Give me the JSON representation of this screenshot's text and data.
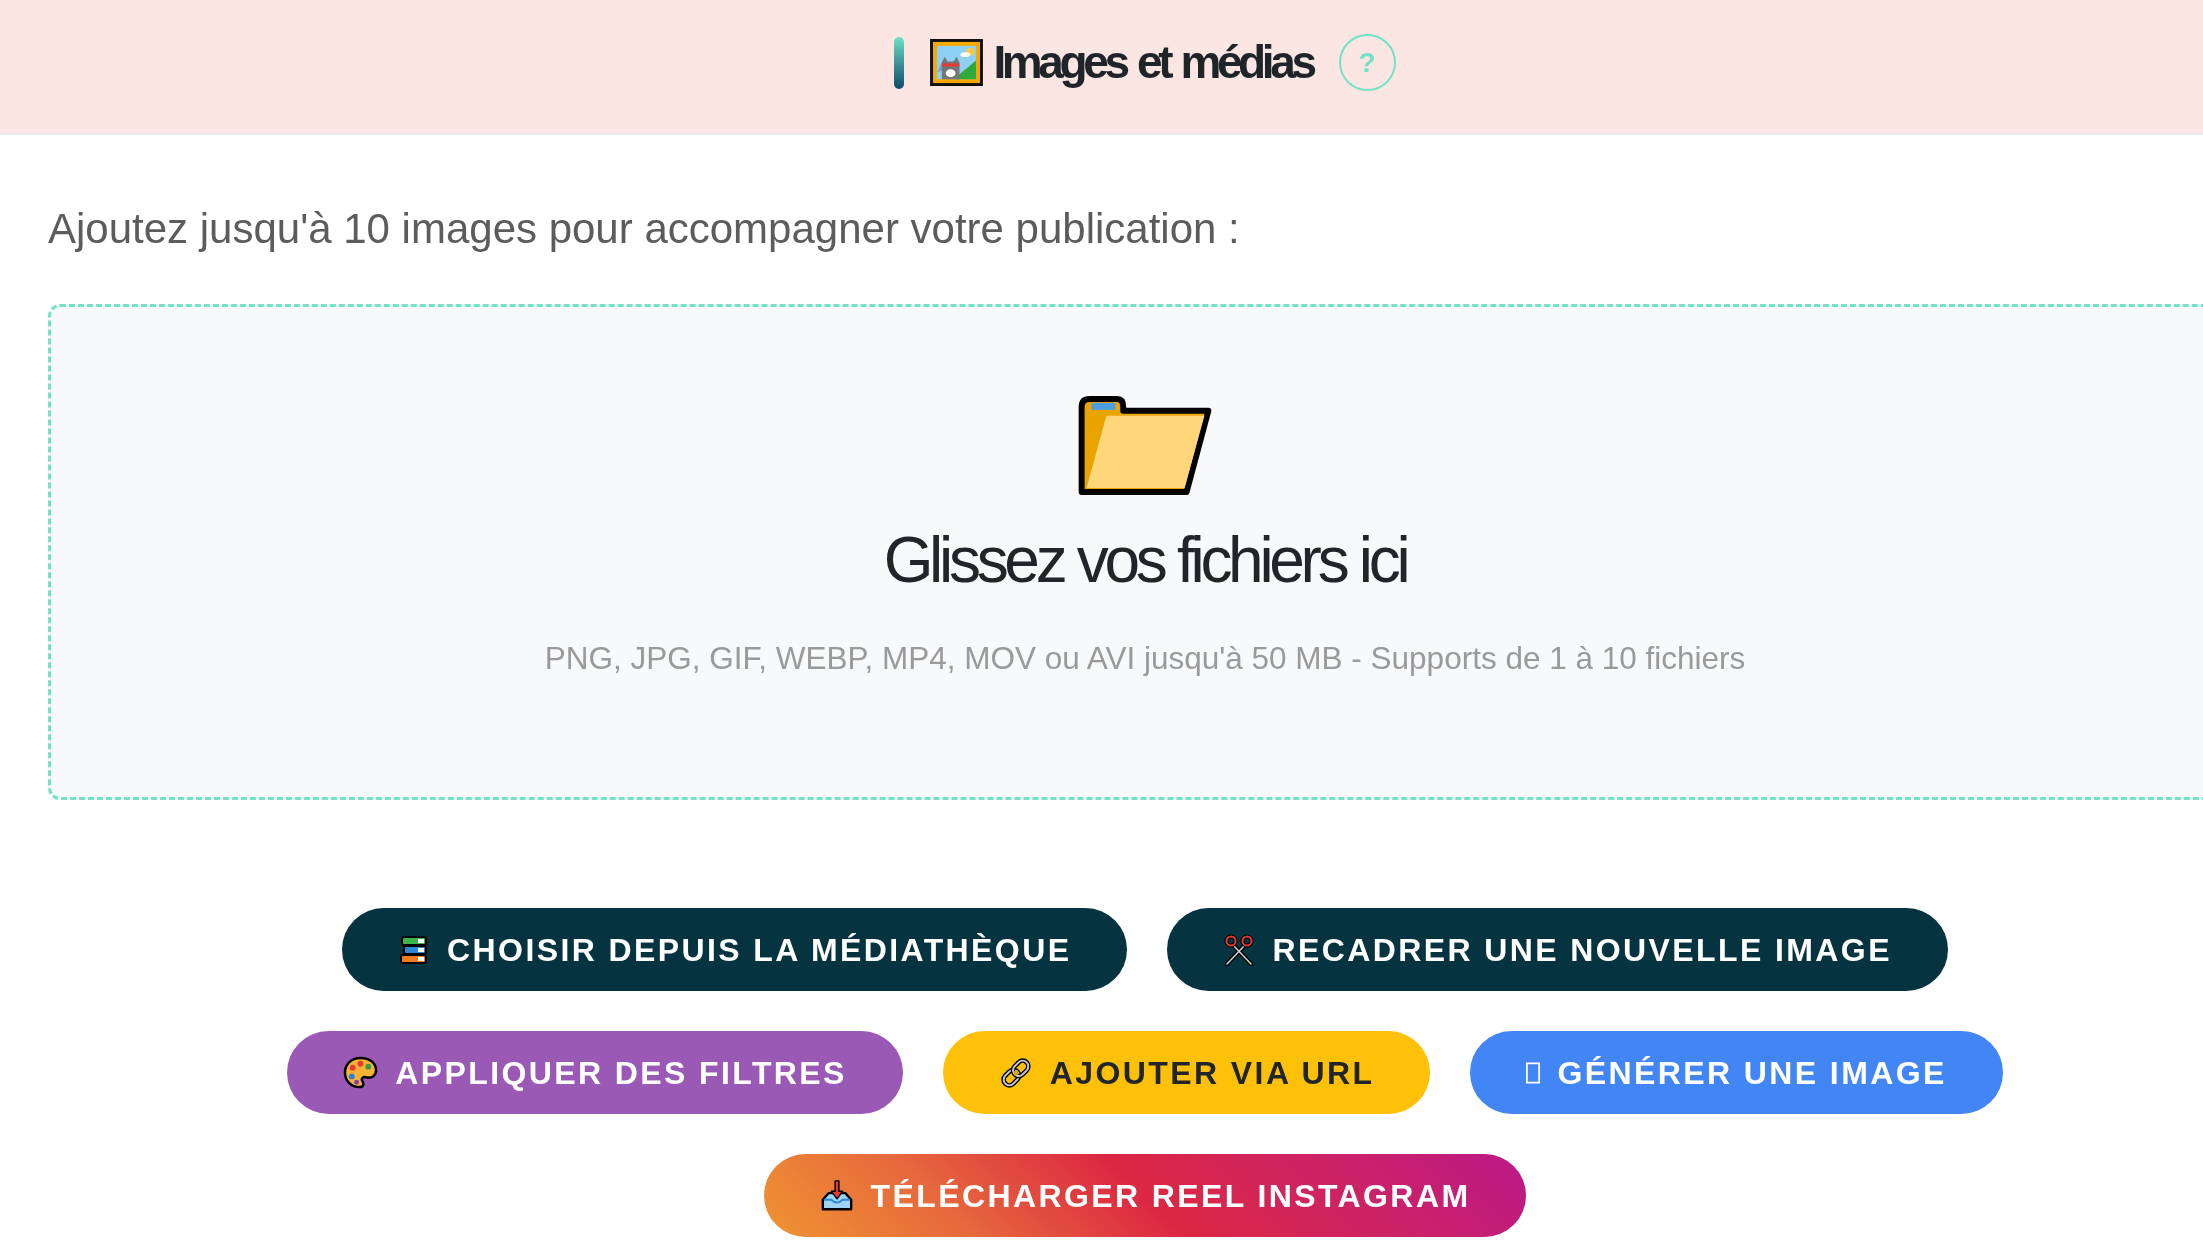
{
  "header": {
    "title": "Images et médias",
    "help": "?"
  },
  "instructions": "Ajoutez jusqu'à 10 images pour accompagner votre publication :",
  "dropzone": {
    "title": "Glissez vos fichiers ici",
    "hint": "PNG, JPG, GIF, WEBP, MP4, MOV ou AVI jusqu'à 50 MB - Supports de 1 à 10 fichiers"
  },
  "action_rows": [
    {
      "buttons": [
        {
          "label": "CHOISIR DEPUIS LA MÉDIATHÈQUE",
          "kind": "dark"
        },
        {
          "label": "RECADRER UNE NOUVELLE IMAGE",
          "kind": "dark"
        }
      ]
    },
    {
      "buttons": [
        {
          "label": "APPLIQUER DES FILTRES",
          "kind": "purple"
        },
        {
          "label": "AJOUTER VIA URL",
          "kind": "yellow"
        },
        {
          "label": "GÉNÉRER UNE IMAGE",
          "kind": "blue"
        }
      ]
    },
    {
      "buttons": [
        {
          "label": "TÉLÉCHARGER REEL INSTAGRAM",
          "kind": "gradient"
        }
      ]
    }
  ]
}
